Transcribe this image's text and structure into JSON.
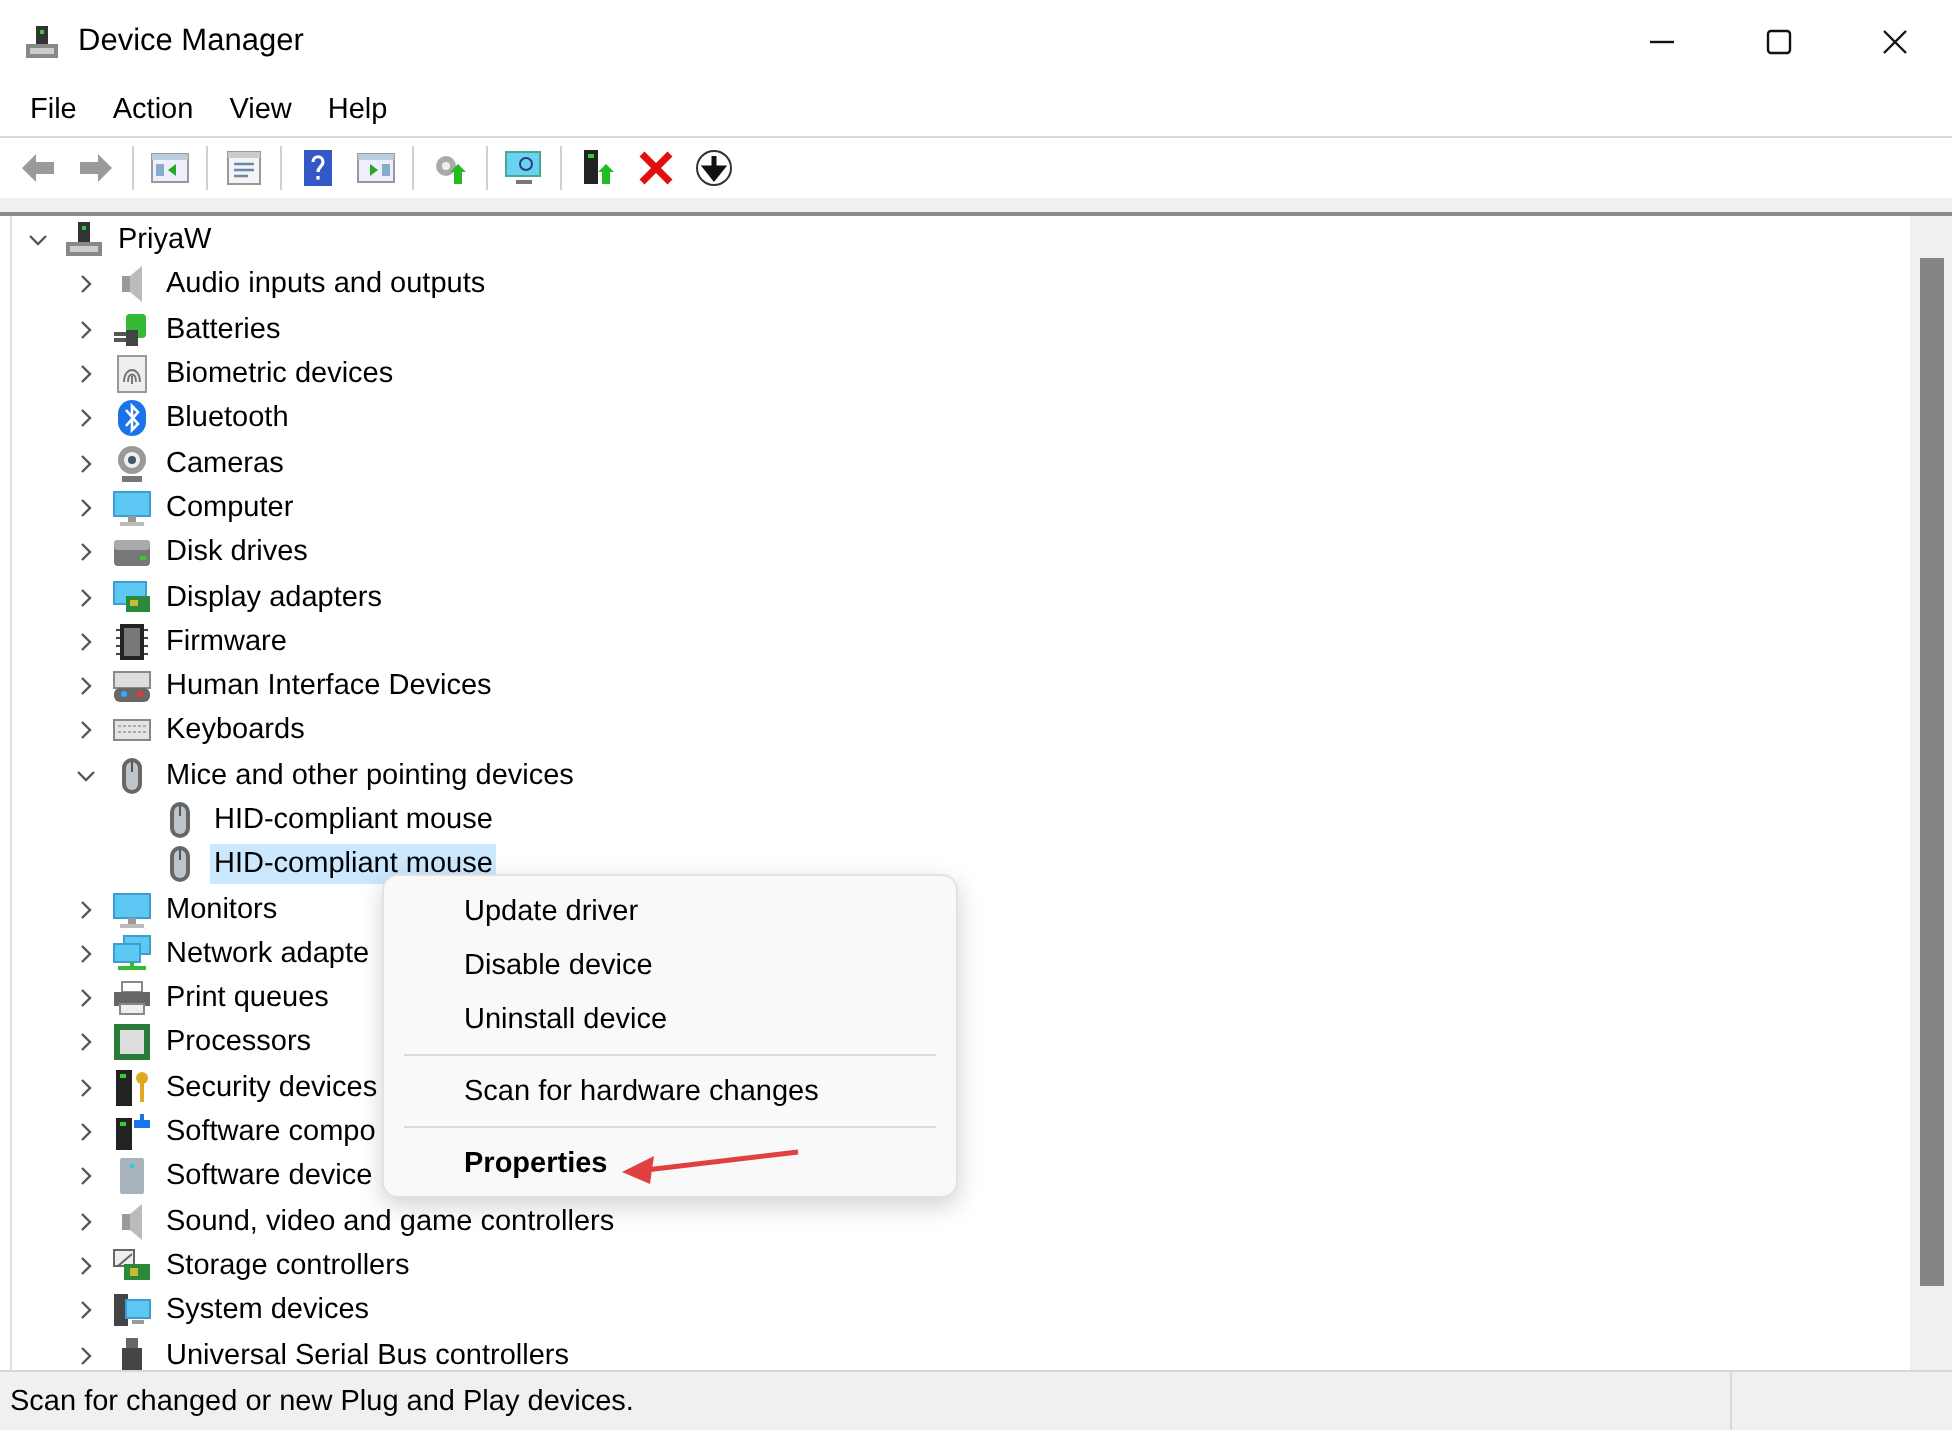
{
  "window": {
    "title": "Device Manager"
  },
  "menu_bar": [
    "File",
    "Action",
    "View",
    "Help"
  ],
  "tree": [
    {
      "label": "PriyaW",
      "expanded": true,
      "selected": false,
      "children": [
        {
          "label": "Audio inputs and outputs",
          "expanded": false,
          "selected": false
        },
        {
          "label": "Batteries",
          "expanded": false,
          "selected": false
        },
        {
          "label": "Biometric devices",
          "expanded": false,
          "selected": false
        },
        {
          "label": "Bluetooth",
          "expanded": false,
          "selected": false
        },
        {
          "label": "Cameras",
          "expanded": false,
          "selected": false
        },
        {
          "label": "Computer",
          "expanded": false,
          "selected": false
        },
        {
          "label": "Disk drives",
          "expanded": false,
          "selected": false
        },
        {
          "label": "Display adapters",
          "expanded": false,
          "selected": false
        },
        {
          "label": "Firmware",
          "expanded": false,
          "selected": false
        },
        {
          "label": "Human Interface Devices",
          "expanded": false,
          "selected": false
        },
        {
          "label": "Keyboards",
          "expanded": false,
          "selected": false
        },
        {
          "label": "Mice and other pointing devices",
          "expanded": true,
          "selected": false,
          "children": [
            {
              "label": "HID-compliant mouse",
              "selected": false
            },
            {
              "label": "HID-compliant mouse",
              "selected": true
            }
          ]
        },
        {
          "label": "Monitors",
          "expanded": false,
          "selected": false
        },
        {
          "label": "Network adapte",
          "expanded": false,
          "selected": false
        },
        {
          "label": "Print queues",
          "expanded": false,
          "selected": false
        },
        {
          "label": "Processors",
          "expanded": false,
          "selected": false
        },
        {
          "label": "Security devices",
          "expanded": false,
          "selected": false
        },
        {
          "label": "Software compo",
          "expanded": false,
          "selected": false
        },
        {
          "label": "Software device",
          "expanded": false,
          "selected": false
        },
        {
          "label": "Sound, video and game controllers",
          "expanded": false,
          "selected": false
        },
        {
          "label": "Storage controllers",
          "expanded": false,
          "selected": false
        },
        {
          "label": "System devices",
          "expanded": false,
          "selected": false
        },
        {
          "label": "Universal Serial Bus controllers",
          "expanded": false,
          "selected": false
        }
      ]
    }
  ],
  "context_menu": [
    {
      "kind": "item",
      "label": "Update driver",
      "default": false
    },
    {
      "kind": "item",
      "label": "Disable device",
      "default": false
    },
    {
      "kind": "item",
      "label": "Uninstall device",
      "default": false
    },
    {
      "kind": "separator"
    },
    {
      "kind": "item",
      "label": "Scan for hardware changes",
      "default": false
    },
    {
      "kind": "separator"
    },
    {
      "kind": "item",
      "label": "Properties",
      "default": true
    }
  ],
  "status_bar": "Scan for changed or new Plug and Play devices."
}
